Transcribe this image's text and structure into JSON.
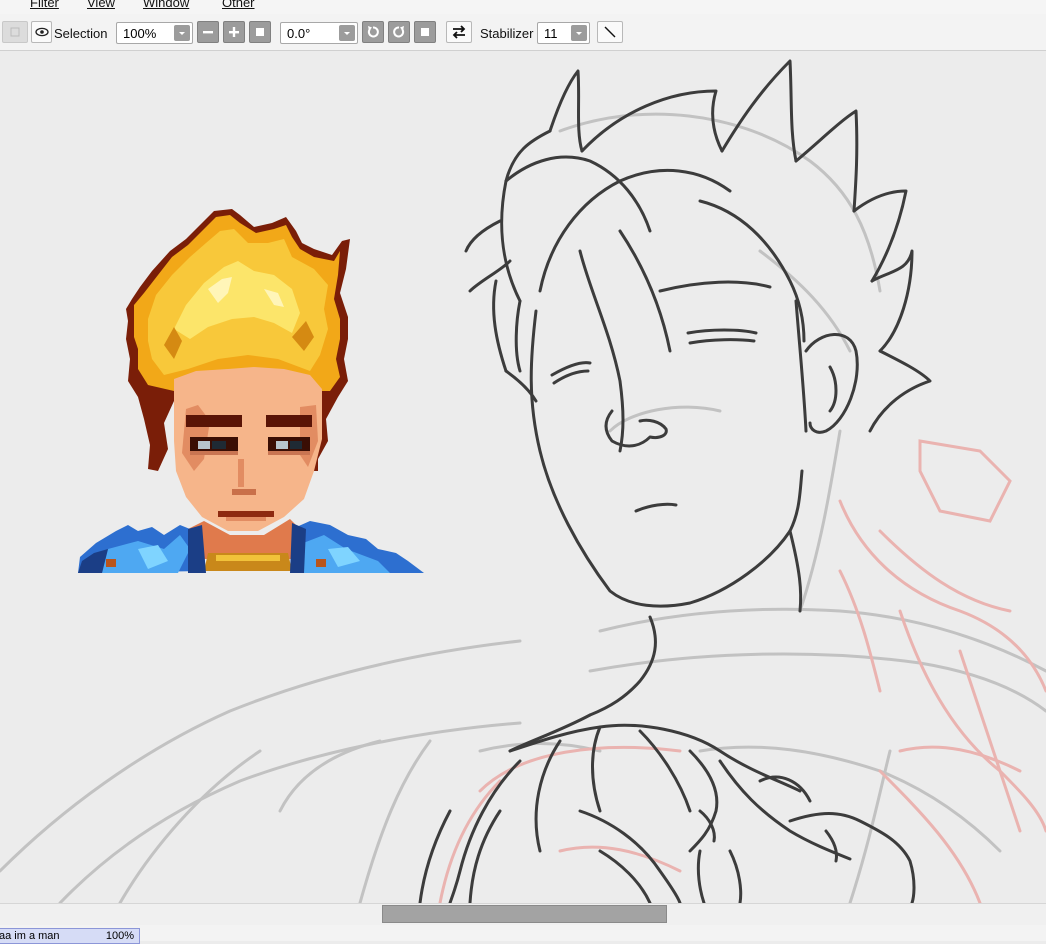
{
  "menu": {
    "items": [
      {
        "label": "Filter"
      },
      {
        "label": "View"
      },
      {
        "label": "Window"
      },
      {
        "label": "Other"
      }
    ]
  },
  "toolbar": {
    "selection_label": "Selection",
    "zoom_value": "100%",
    "rotation_value": "0.0°",
    "stabilizer_label": "Stabilizer",
    "stabilizer_value": "11"
  },
  "document_tab": {
    "name": "aa im a man",
    "zoom": "100%"
  },
  "colors": {
    "canvas_bg": "#ececec",
    "sketch_dark": "#3a3a3a",
    "sketch_light": "#bdbdbd",
    "sketch_red": "#e8a3a0",
    "tab_bg": "#d6dcf6"
  },
  "icons": [
    "eye-icon",
    "minus-icon",
    "plus-icon",
    "reset-icon",
    "rotate-left-icon",
    "rotate-right-icon",
    "flip-icon",
    "line-tool-icon"
  ]
}
